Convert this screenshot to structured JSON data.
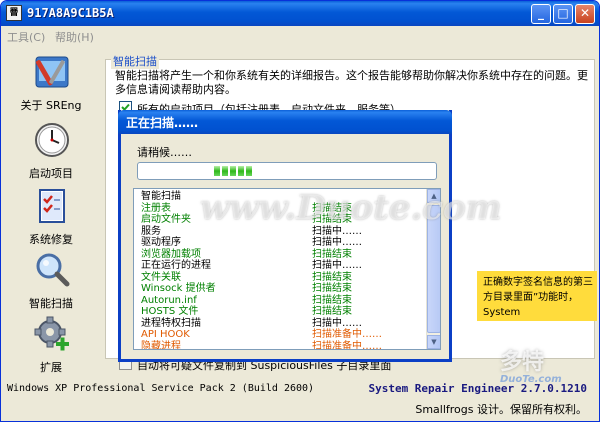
{
  "window": {
    "title": "917A8A9C1B5A",
    "icon_glyph": "罾",
    "controls": {
      "minimize": "_",
      "maximize": "□",
      "close": "✕"
    }
  },
  "menu": {
    "tools": "工具(C)",
    "help": "帮助(H)"
  },
  "sidebar": {
    "items": [
      {
        "label": "关于 SREng",
        "icon": "tools-icon"
      },
      {
        "label": "启动项目",
        "icon": "clock-icon"
      },
      {
        "label": "系统修复",
        "icon": "checklist-icon"
      },
      {
        "label": "智能扫描",
        "icon": "magnifier-icon"
      },
      {
        "label": "扩展",
        "icon": "gear-plus-icon"
      }
    ]
  },
  "content": {
    "section_title": "智能扫描",
    "description": "智能扫描将产生一个和你系统有关的详细报告。这个报告能够帮助你解决你系统中存在的问题。更多信息请阅读帮助内容。",
    "checkbox_1": "所有的启动项目（包括注册表、启动文件夹、服务等）",
    "notice": "正确数字签名信息的第三方目录里面”功能时，System",
    "checkbox_2": "自动将可疑文件复制到 SuspiciousFiles 子目录里面"
  },
  "status": {
    "os": "Windows XP Professional Service Pack 2 (Build 2600)",
    "product": "System Repair Engineer 2.7.0.1210",
    "company": "Smallfrogs 设计。保留所有权利。"
  },
  "scan_dialog": {
    "title": "正在扫描……",
    "please_wait": "请稍候……",
    "progress_blocks": 5,
    "items": [
      {
        "name": "智能扫描",
        "status": "",
        "color": "#000000"
      },
      {
        "name": "注册表",
        "status": "扫描结束",
        "color": "#008000"
      },
      {
        "name": "启动文件夹",
        "status": "扫描结束",
        "color": "#008000"
      },
      {
        "name": "服务",
        "status": "扫描中……",
        "color": "#000000"
      },
      {
        "name": "驱动程序",
        "status": "扫描中……",
        "color": "#000000"
      },
      {
        "name": "浏览器加载项",
        "status": "扫描结束",
        "color": "#008000"
      },
      {
        "name": "正在运行的进程",
        "status": "扫描中……",
        "color": "#000000"
      },
      {
        "name": "文件关联",
        "status": "扫描结束",
        "color": "#008000"
      },
      {
        "name": "Winsock 提供者",
        "status": "扫描结束",
        "color": "#008000"
      },
      {
        "name": "Autorun.inf",
        "status": "扫描结束",
        "color": "#008000"
      },
      {
        "name": "HOSTS 文件",
        "status": "扫描结束",
        "color": "#008000"
      },
      {
        "name": "进程特权扫描",
        "status": "扫描中……",
        "color": "#000000"
      },
      {
        "name": "API HOOK",
        "status": "扫描准备中……",
        "color": "#e05a00"
      },
      {
        "name": "隐藏进程",
        "status": "扫描准备中……",
        "color": "#e05a00"
      }
    ]
  },
  "watermarks": {
    "center": "www.Duote.com",
    "logo": "多特",
    "sub": "DuoTe.com"
  }
}
